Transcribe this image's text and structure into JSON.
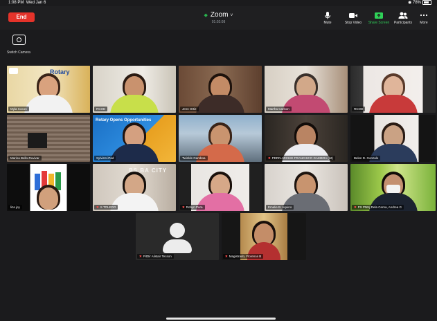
{
  "status_bar": {
    "time": "1:08 PM",
    "date": "Wed Jan 6",
    "wifi": "◉",
    "battery": "78%"
  },
  "meeting": {
    "end_label": "End",
    "title": "Zoom",
    "elapsed": "01:02:08",
    "shield_glyph": "◆",
    "chevron_glyph": "˅"
  },
  "toolbar": [
    {
      "label": "Mute",
      "icon": "microphone-icon",
      "accent": "#eaeaea"
    },
    {
      "label": "Stop Video",
      "icon": "video-camera-icon",
      "accent": "#eaeaea"
    },
    {
      "label": "Share Screen",
      "icon": "share-screen-icon",
      "accent": "#2fd158"
    },
    {
      "label": "Participants",
      "icon": "participants-icon",
      "accent": "#eaeaea"
    },
    {
      "label": "More",
      "icon": "more-icon",
      "accent": "#eaeaea"
    }
  ],
  "switch_camera_label": "Switch Camera",
  "participants": [
    {
      "name": "Myla Cocon",
      "muted": false,
      "active": true
    },
    {
      "name": "RCOD",
      "muted": false,
      "active": false
    },
    {
      "name": "Jenn Ortiz",
      "muted": false,
      "active": false
    },
    {
      "name": "Martha Carlson",
      "muted": false,
      "active": false
    },
    {
      "name": "RCOD",
      "muted": false,
      "active": false
    },
    {
      "name": "Marina Bello-Ruvivar",
      "muted": false,
      "active": false
    },
    {
      "name": "Sylvia's iPad",
      "muted": false,
      "active": false
    },
    {
      "name": "Twinkle Gamboa",
      "muted": false,
      "active": false
    },
    {
      "name": "PDRN ARCHIE FRANCISCO GAMBOA (lst)",
      "muted": true,
      "active": false
    },
    {
      "name": "Belen D. Gonzalo",
      "muted": false,
      "active": false
    },
    {
      "name": "liza joy",
      "muted": false,
      "active": false
    },
    {
      "name": "S TOLEDO",
      "muted": true,
      "active": false
    },
    {
      "name": "Robyn Pura",
      "muted": true,
      "active": false
    },
    {
      "name": "Emelie B. Aquino",
      "muted": false,
      "active": false
    },
    {
      "name": "PS PNNj Dela Cerna, Andrea G",
      "muted": true,
      "active": false
    },
    {
      "name": "PitDir Alistair Tecson",
      "muted": true,
      "active": false
    },
    {
      "name": "Magistrado, Florence B",
      "muted": true,
      "active": false
    }
  ],
  "backgrounds": {
    "rotary_banner_text": "Rotary",
    "rotary_opens_text": "Rotary Opens Opportunities",
    "sign_text": "BS BA CITY"
  },
  "colors": {
    "end": "#e5332a",
    "active_speaker": "#f5d823",
    "muted_icon": "#ff4b4b"
  }
}
